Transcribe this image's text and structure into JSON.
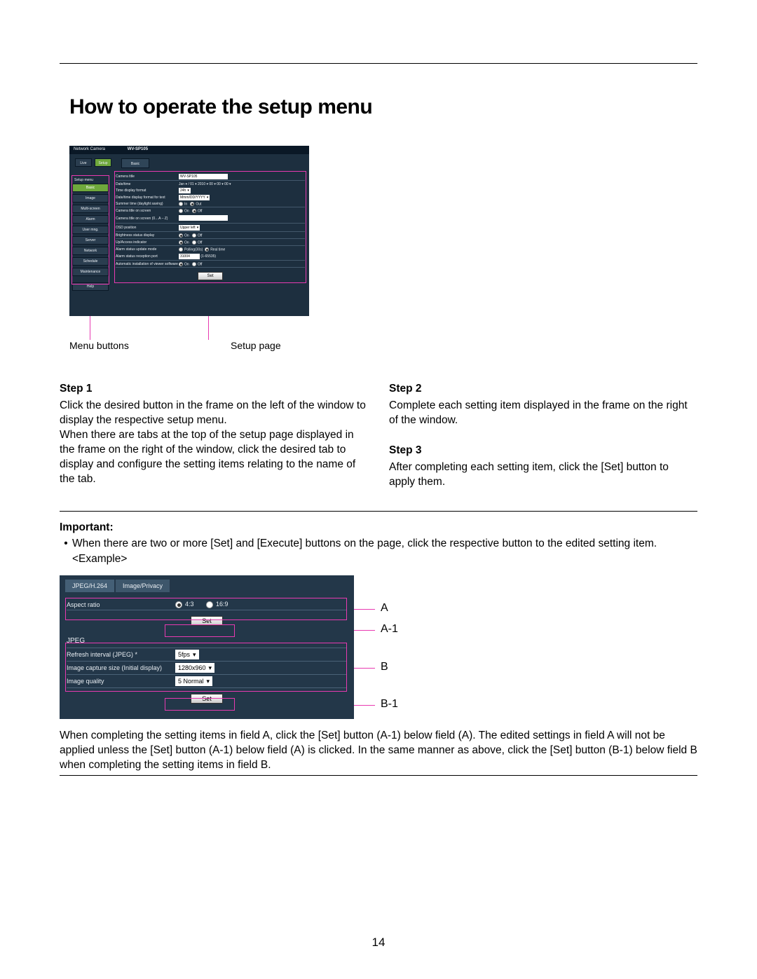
{
  "page_number": "14",
  "title": "How to operate the setup menu",
  "shot1": {
    "brand": "Network Camera",
    "model": "WV-SP105",
    "tab_basic": "Basic",
    "btn_live": "Live",
    "btn_setup": "Setup",
    "side_header": "Setup menu",
    "side_items": [
      "Basic",
      "Image",
      "Multi-screen",
      "Alarm",
      "User mng.",
      "Server",
      "Network",
      "Schedule",
      "Maintenance"
    ],
    "side_help": "Help",
    "rows": [
      {
        "label": "Camera title",
        "field": "WV-SP105",
        "type": "input"
      },
      {
        "label": "Date/time",
        "field": "Jan ▾ / 01 ▾ 2010 ▾  00 ▾ 00 ▾ 00 ▾",
        "type": "selects"
      },
      {
        "label": "Time display format",
        "field": "24h",
        "type": "select"
      },
      {
        "label": "Date/time display format for text",
        "field": "Mmm/DD/YYYY",
        "type": "select"
      },
      {
        "label": "Summer time (daylight saving)",
        "field": "In   • Out",
        "type": "radio"
      },
      {
        "label": "Camera title on screen",
        "field": "Off   • Off",
        "type": "radio"
      },
      {
        "label": "Camera title on screen (0…A – Z)",
        "field": "",
        "type": "input"
      },
      {
        "label": "OSD position",
        "field": "Upper left",
        "type": "select"
      },
      {
        "label": "Brightness status display",
        "field": "• On    Off",
        "type": "radio"
      },
      {
        "label": "Up/Access indicator",
        "field": "• On    Off",
        "type": "radio"
      },
      {
        "label": "Alarm status update mode",
        "field": "Polling(30s)   • Real time",
        "type": "radio"
      },
      {
        "label": "Alarm status reception port",
        "field": "31004   (1-65535)",
        "type": "input"
      },
      {
        "label": "Automatic installation of viewer software",
        "field": "• On    Off",
        "type": "radio"
      }
    ],
    "set": "Set"
  },
  "labels1": {
    "left": "Menu buttons",
    "right": "Setup page"
  },
  "steps": {
    "s1_h": "Step 1",
    "s1_p1": "Click the desired button in the frame on the left of the window to display the respective setup menu.",
    "s1_p2": "When there are tabs at the top of the setup page displayed in the frame on the right of the window, click the desired tab to display and configure the setting items relating to the name of the tab.",
    "s2_h": "Step 2",
    "s2_p": "Complete each setting item displayed in the frame on the right of the window.",
    "s3_h": "Step 3",
    "s3_p": "After completing each setting item, click the [Set] button to apply them."
  },
  "important_h": "Important:",
  "important_b": "When there are two or more [Set] and [Execute] buttons on the page, click the respective button to the edited setting item.",
  "example": "<Example>",
  "shot2": {
    "tab1": "JPEG/H.264",
    "tab2": "Image/Privacy",
    "aspect": "Aspect ratio",
    "ar_43": "4:3",
    "ar_169": "16:9",
    "jpeg": "JPEG",
    "refresh": "Refresh interval (JPEG) *",
    "refresh_v": "5fps",
    "capsize": "Image capture size (Initial display)",
    "capsize_v": "1280x960",
    "quality": "Image quality",
    "quality_v": "5 Normal",
    "set": "Set"
  },
  "annot": {
    "A": "A",
    "A1": "A-1",
    "B": "B",
    "B1": "B-1"
  },
  "closing": "When completing the setting items in field A, click the [Set] button (A-1) below field (A). The edited settings in field A will not be applied unless the [Set] button (A-1) below field (A) is clicked. In the same manner as above, click the [Set] button (B-1) below field B when completing the setting items in field B."
}
